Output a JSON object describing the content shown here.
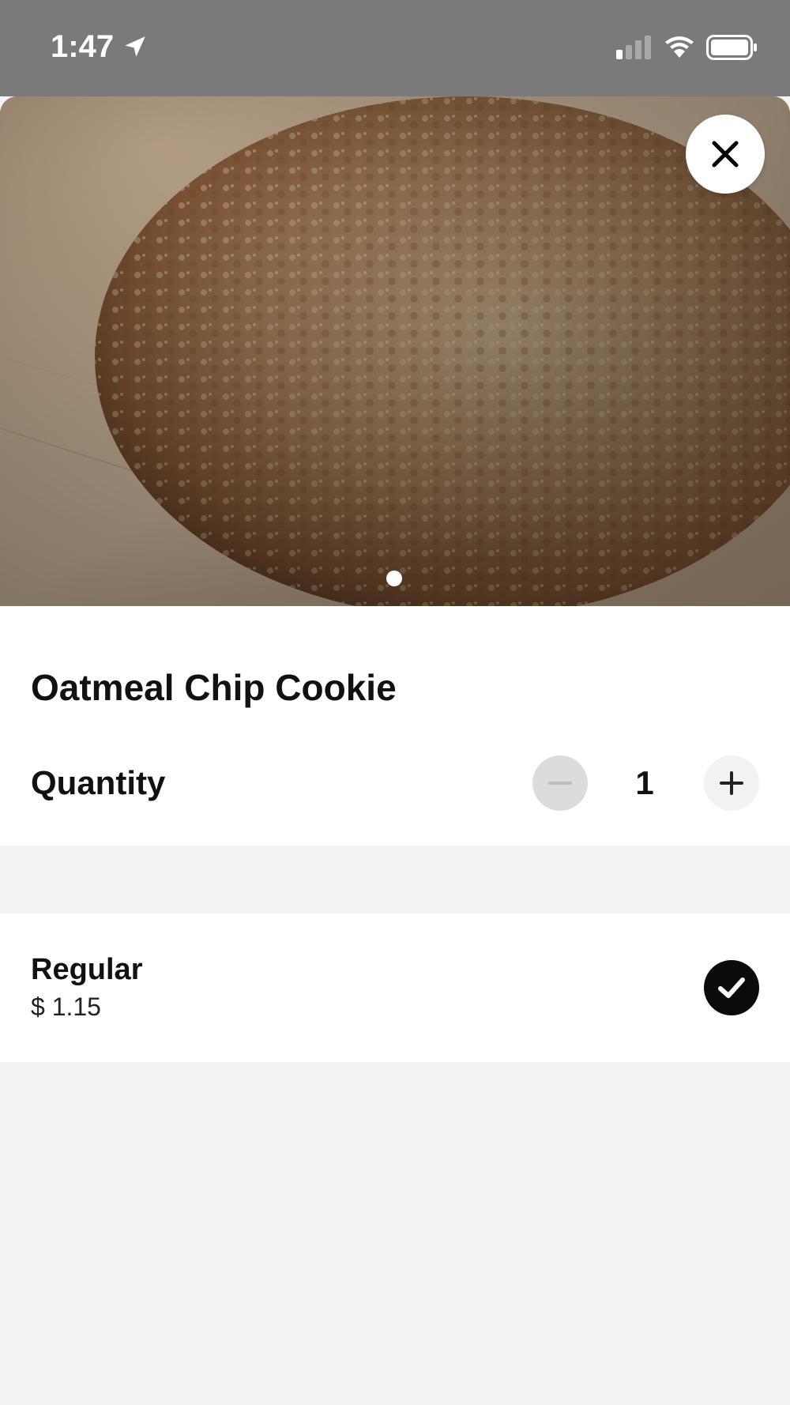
{
  "status_bar": {
    "time": "1:47",
    "icons": [
      "location-arrow-icon",
      "cellular-signal-icon",
      "wifi-icon",
      "battery-icon"
    ]
  },
  "hero": {
    "image": "oatmeal-cookie-photo",
    "close_icon": "close-icon",
    "page_indicator": {
      "count": 1,
      "active": 1
    }
  },
  "product": {
    "title": "Oatmeal Chip Cookie"
  },
  "quantity": {
    "label": "Quantity",
    "value": "1",
    "decrement_icon": "minus-icon",
    "increment_icon": "plus-icon"
  },
  "options": [
    {
      "name": "Regular",
      "price": "$ 1.15",
      "selected": true,
      "icon": "checkmark-icon"
    }
  ],
  "colors": {
    "status_bar": "#7a7a7a",
    "background": "#f3f3f3",
    "card": "#ffffff",
    "text": "#111111",
    "selected_check": "#0b0b0b",
    "disabled_button": "#dcdcdc"
  }
}
